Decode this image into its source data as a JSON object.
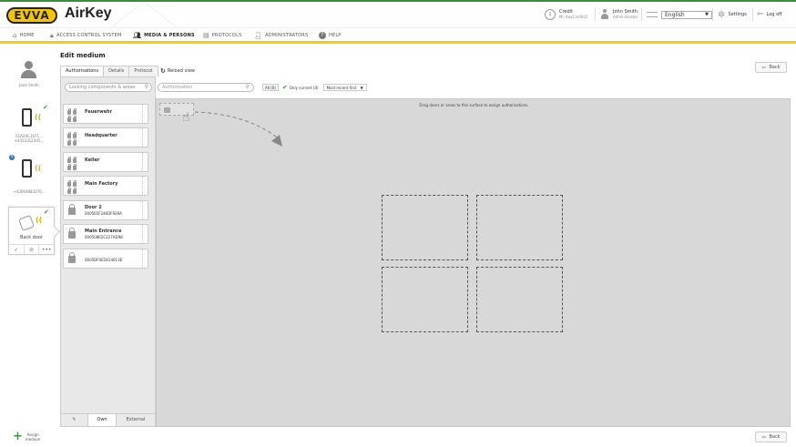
{
  "header": {
    "logo": "EVVA",
    "app_title": "AirKey",
    "credit_label": "Credit",
    "credit_sub": "Mr. KeyCredits2",
    "user_name": "John Smith",
    "user_role": "Administrator",
    "language": "English",
    "settings_label": "Settings",
    "logoff_label": "Log off"
  },
  "nav": {
    "items": [
      {
        "label": "HOME"
      },
      {
        "label": "ACCESS CONTROL SYSTEM"
      },
      {
        "label": "MEDIA & PERSONS"
      },
      {
        "label": "PROTOCOLS"
      },
      {
        "label": "ADMINISTRATORS"
      },
      {
        "label": "HELP"
      }
    ]
  },
  "person": {
    "name": "Jane Smith"
  },
  "media": [
    {
      "id": "01A2AC1671...",
      "phone": "+43123123​45..."
    },
    {
      "phone": "+43664883370..."
    },
    {
      "name": "Back door"
    }
  ],
  "assign_medium": {
    "line1": "Assign",
    "line2": "medium"
  },
  "main": {
    "title": "Edit medium",
    "back_label": "Back",
    "tabs": [
      {
        "label": "Authorisations"
      },
      {
        "label": "Details"
      },
      {
        "label": "Protocol"
      }
    ],
    "reload_label": "Reload view",
    "locking_search_placeholder": "Locking components & areas",
    "auth_search_placeholder": "Authorisation",
    "all_badge": "All (0)",
    "only_current": "Only current (0)",
    "sort_value": "Most recent first",
    "drop_hint": "Drag doors or areas to this surface to assign authorisations."
  },
  "locking_items": [
    {
      "name": "Feuerwehr",
      "kind": "area"
    },
    {
      "name": "Headquarter",
      "kind": "area"
    },
    {
      "name": "Keller",
      "kind": "area"
    },
    {
      "name": "Main Factory",
      "kind": "area"
    },
    {
      "name": "Door 2",
      "code": "000565F246DF929A",
      "kind": "door"
    },
    {
      "name": "Main Entrance",
      "code": "000508E2C227AD98",
      "kind": "door"
    },
    {
      "name": "",
      "code": "0005DF0E1B14013E",
      "kind": "door"
    }
  ],
  "bottom_tabs": {
    "own": "Own",
    "external": "External"
  },
  "icons": {
    "home": "home-icon",
    "lock": "lock-icon",
    "persons": "persons-icon",
    "protocol": "document-icon",
    "admins": "admins-icon",
    "help": "help-icon"
  },
  "colors": {
    "brand_yellow": "#f5c400",
    "nav_stripe": "#f5d000",
    "check_green": "#3a9c3a",
    "info_blue": "#2b6fc0"
  }
}
